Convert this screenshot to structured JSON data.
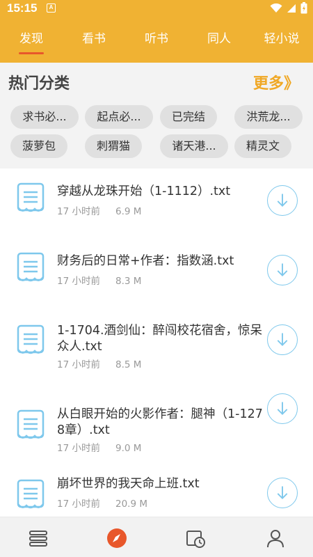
{
  "status": {
    "time": "15:15",
    "notif_letter": "A"
  },
  "tabs": [
    {
      "label": "发现",
      "active": true
    },
    {
      "label": "看书",
      "active": false
    },
    {
      "label": "听书",
      "active": false
    },
    {
      "label": "同人",
      "active": false
    },
    {
      "label": "轻小说",
      "active": false
    }
  ],
  "hot": {
    "title": "热门分类",
    "more": "更多》",
    "chips": [
      "求书必...",
      "起点必...",
      "已完结",
      "洪荒龙...",
      "菠萝包",
      "刺猬猫",
      "诸天港...",
      "精灵文"
    ]
  },
  "files": [
    {
      "title": "穿越从龙珠开始（1-1112）.txt",
      "time": "17 小时前",
      "size": "6.9 M"
    },
    {
      "title": "财务后的日常+作者：指数涵.txt",
      "time": "17 小时前",
      "size": "8.3 M"
    },
    {
      "title": "1-1704.酒剑仙：醉闯校花宿舍，惊呆众人.txt",
      "time": "17 小时前",
      "size": "8.5 M"
    },
    {
      "title": "从白眼开始的火影作者：腿神（1-1278章）.txt",
      "time": "17 小时前",
      "size": "9.0 M"
    },
    {
      "title": "崩坏世界的我天命上班.txt",
      "time": "17 小时前",
      "size": "20.9 M"
    }
  ],
  "colors": {
    "accent": "#f0b233",
    "tab_indicator": "#e8572b",
    "download": "#7ec8ec"
  },
  "bottom_nav": [
    "bookshelf-icon",
    "discover-compass-icon",
    "history-icon",
    "profile-icon"
  ]
}
